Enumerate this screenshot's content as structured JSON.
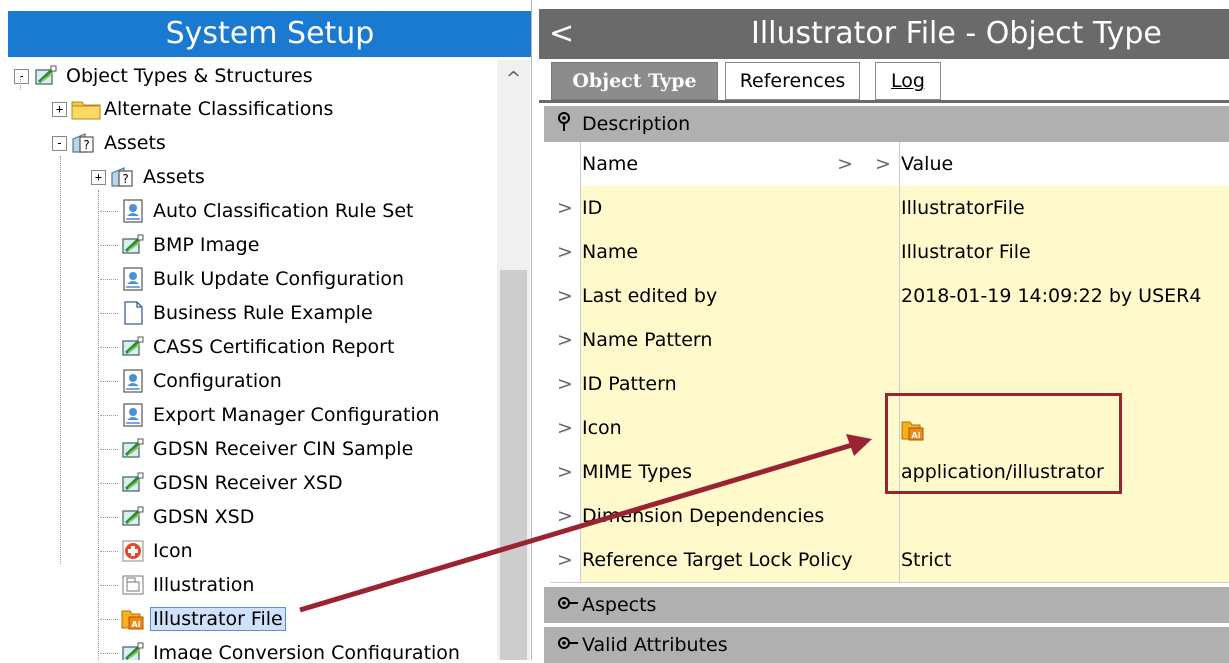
{
  "left_panel": {
    "title": "System Setup",
    "tree": [
      {
        "label": "Object Types & Structures",
        "icon": "object-type-icon",
        "expander": "-"
      },
      {
        "label": "Alternate Classifications",
        "icon": "folder-icon",
        "expander": "+"
      },
      {
        "label": "Assets",
        "icon": "asset-type-icon",
        "expander": "-"
      },
      {
        "label": "Assets",
        "icon": "asset-type-icon",
        "expander": "+"
      },
      {
        "label": "Auto Classification Rule Set",
        "icon": "config-doc-icon"
      },
      {
        "label": "BMP Image",
        "icon": "object-type-icon"
      },
      {
        "label": "Bulk Update Configuration",
        "icon": "config-doc-icon"
      },
      {
        "label": "Business Rule Example",
        "icon": "blank-doc-icon"
      },
      {
        "label": "CASS Certification Report",
        "icon": "object-type-icon"
      },
      {
        "label": "Configuration",
        "icon": "config-doc-icon"
      },
      {
        "label": "Export Manager Configuration",
        "icon": "config-doc-icon"
      },
      {
        "label": "GDSN Receiver CIN Sample",
        "icon": "object-type-icon"
      },
      {
        "label": "GDSN Receiver XSD",
        "icon": "object-type-icon"
      },
      {
        "label": "GDSN XSD",
        "icon": "object-type-icon"
      },
      {
        "label": "Icon",
        "icon": "icon-type-icon"
      },
      {
        "label": "Illustration",
        "icon": "illustration-icon"
      },
      {
        "label": "Illustrator File",
        "icon": "illustrator-file-icon",
        "selected": true
      },
      {
        "label": "Image Conversion Configuration",
        "icon": "object-type-icon"
      }
    ]
  },
  "right_panel": {
    "back_label": "<",
    "title": "Illustrator File - Object Type",
    "tabs": {
      "object_type": "Object Type",
      "references": "References",
      "log": "Log"
    },
    "sections": {
      "description": "Description",
      "aspects": "Aspects",
      "valid_attributes": "Valid Attributes"
    },
    "grid_header": {
      "name": "Name",
      "value": "Value"
    },
    "rows": [
      {
        "name": "ID",
        "value": "IllustratorFile"
      },
      {
        "name": "Name",
        "value": "Illustrator File"
      },
      {
        "name": "Last edited by",
        "value": "2018-01-19 14:09:22 by USER4"
      },
      {
        "name": "Name Pattern",
        "value": ""
      },
      {
        "name": "ID Pattern",
        "value": ""
      },
      {
        "name": "Icon",
        "value": "",
        "value_icon": "illustrator-file-icon"
      },
      {
        "name": "MIME Types",
        "value": "application/illustrator"
      },
      {
        "name": "Dimension Dependencies",
        "value": ""
      },
      {
        "name": "Reference Target Lock Policy",
        "value": "Strict"
      }
    ]
  },
  "colors": {
    "left_title_bg": "#1a7ad2",
    "right_title_bg": "#6a6a6a",
    "row_bg": "#fff9cc",
    "annotation": "#9b2230",
    "selected_bg": "#cfe1fb"
  }
}
